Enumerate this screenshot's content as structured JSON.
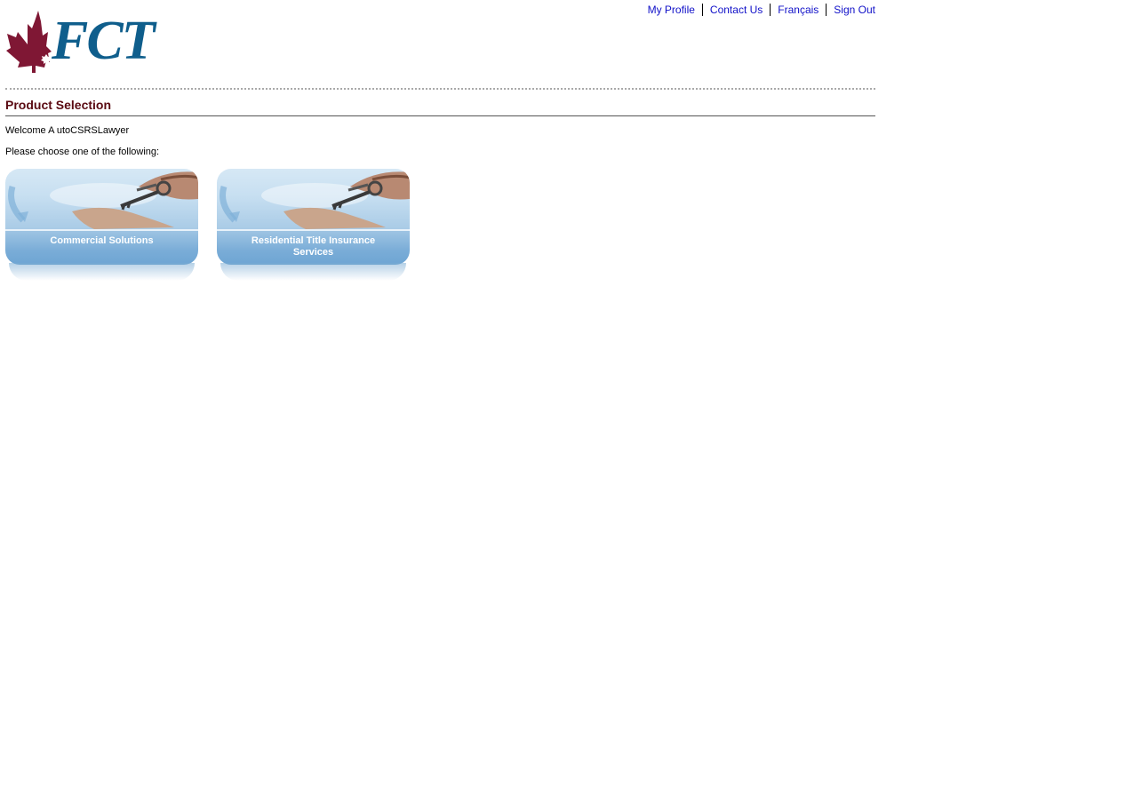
{
  "header": {
    "logo_text": "FCT",
    "links": [
      {
        "label": "My Profile"
      },
      {
        "label": "Contact Us"
      },
      {
        "label": "Français"
      },
      {
        "label": "Sign Out"
      }
    ]
  },
  "page": {
    "title": "Product Selection",
    "welcome": "Welcome A utoCSRSLawyer",
    "prompt": "Please choose one of the following:"
  },
  "products": [
    {
      "label_line1": "Commercial Solutions",
      "label_line2": ""
    },
    {
      "label_line1": "Residential Title Insurance",
      "label_line2": "Services"
    }
  ],
  "colors": {
    "link": "#1010c8",
    "title": "#5a0a12",
    "logo_blue": "#0f5e8c",
    "logo_maple": "#7f1734"
  }
}
